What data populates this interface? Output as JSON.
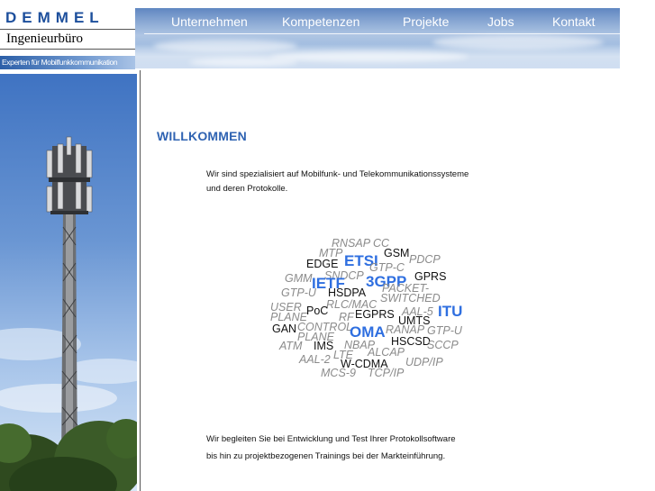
{
  "brand": {
    "name": "DEMMEL",
    "subtitle": "Ingenieurbüro",
    "tagline": "Experten für Mobilfunkkommunikation"
  },
  "nav": {
    "items": [
      {
        "label": "Unternehmen"
      },
      {
        "label": "Kompetenzen"
      },
      {
        "label": "Projekte"
      },
      {
        "label": "Jobs"
      },
      {
        "label": "Kontakt"
      }
    ]
  },
  "main": {
    "heading": "WILLKOMMEN",
    "intro_line1": "Wir sind spezialisiert auf Mobilfunk- und Telekommunikationssysteme",
    "intro_line2": "und deren Protokolle.",
    "outro_line1": "Wir begleiten Sie bei Entwicklung und Test Ihrer Protokollsoftware",
    "outro_line2": "bis hin zu projektbezogenen Trainings bei der Markteinführung."
  },
  "word_cloud": {
    "words": [
      "RNSAP",
      "CC",
      "MTP",
      "GSM",
      "EDGE",
      "ETSI",
      "PDCP",
      "GTP-C",
      "GMM",
      "SNDCP",
      "GPRS",
      "IETF",
      "3GPP",
      "PACKET-",
      "GTP-U",
      "HSDPA",
      "SWITCHED",
      "USER",
      "RLC/MAC",
      "AAL-5",
      "ITU",
      "PLANE",
      "PoC",
      "RF",
      "EGPRS",
      "UMTS",
      "CONTROL",
      "GAN",
      "RANAP",
      "GTP-U",
      "PLANE",
      "OMA",
      "ATM",
      "IMS",
      "NBAP",
      "HSCSD",
      "SCCP",
      "AAL-2",
      "LTE",
      "ALCAP",
      "W-CDMA",
      "UDP/IP",
      "MCS-9",
      "TCP/IP"
    ]
  },
  "colors": {
    "brand_blue": "#1d4f9c",
    "heading_blue": "#2f63b2",
    "cloud_blue": "#2f6fe0",
    "cloud_grey": "#8b8b8b"
  }
}
